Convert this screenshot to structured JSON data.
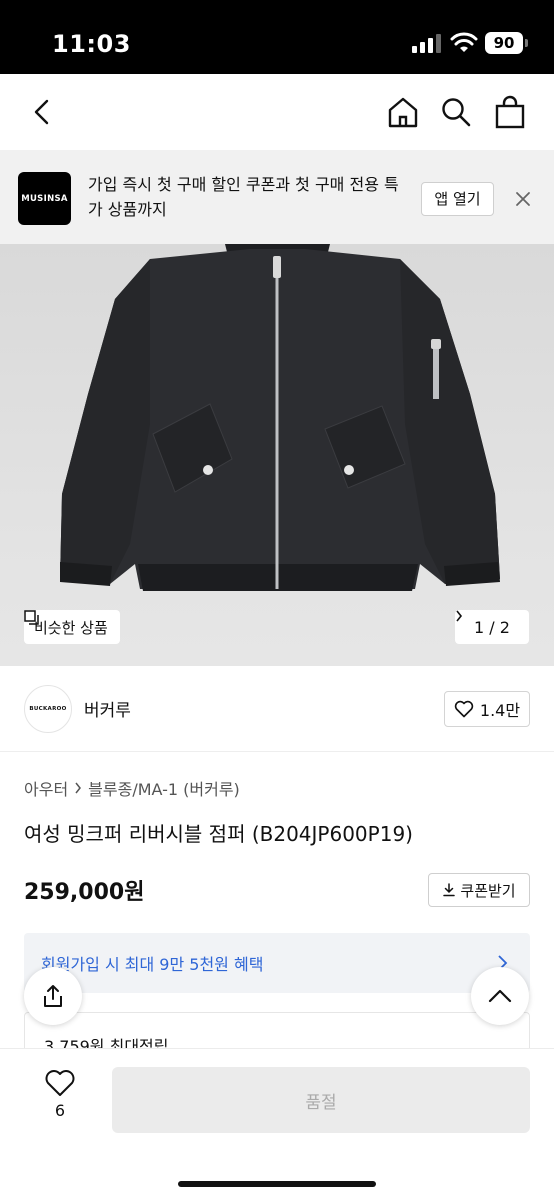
{
  "status_bar": {
    "time": "11:03",
    "battery": "90"
  },
  "navbar": {
    "back": "back",
    "icons": [
      "home-icon",
      "search-icon",
      "bag-icon"
    ]
  },
  "app_banner": {
    "logo_text": "MUSINSA",
    "message": "가입 즉시 첫 구매 할인 쿠폰과 첫 구매 전용 특가 상품까지",
    "open_label": "앱 열기"
  },
  "gallery": {
    "similar_label": "비슷한 상품",
    "page_indicator": "1 / 2"
  },
  "brand": {
    "logo_text": "BUCKAROO",
    "name": "버커루",
    "likes": "1.4만"
  },
  "product": {
    "breadcrumb": [
      "아우터",
      "블루종/MA-1 (버커루)"
    ],
    "title": "여성 밍크퍼 리버시블 점퍼 (B204JP600P19)",
    "price": "259,000원",
    "coupon_label": "쿠폰받기"
  },
  "benefit": {
    "text": "회원가입 시 최대 9만 5천원 혜택"
  },
  "points": {
    "text": "3,759원 최대적립"
  },
  "bottom_bar": {
    "wish_count": "6",
    "soldout_label": "품절"
  },
  "colors": {
    "accent_blue": "#2f66d6",
    "benefit_bg": "#f1f3f6"
  }
}
